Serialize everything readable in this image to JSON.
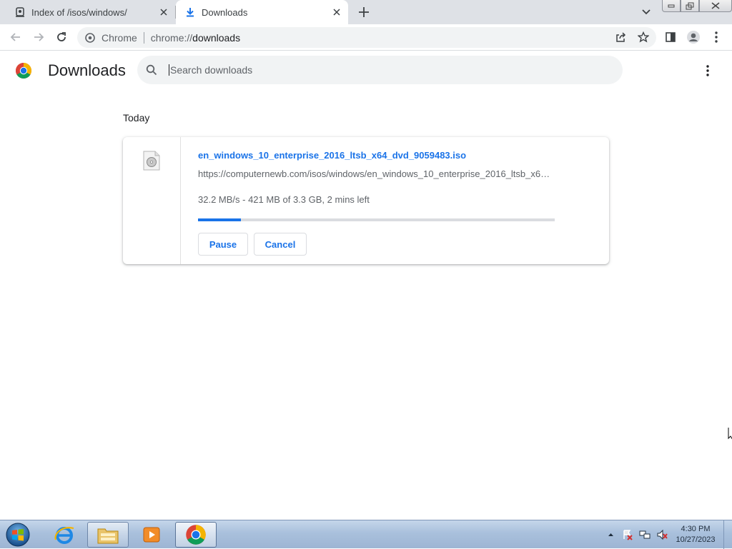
{
  "browser": {
    "tabs": [
      {
        "title": "Index of /isos/windows/",
        "icon": "server-icon",
        "active": false
      },
      {
        "title": "Downloads",
        "icon": "download-icon",
        "active": true
      }
    ],
    "omnibox": {
      "chip": "Chrome",
      "url_scheme": "chrome://",
      "url_host": "downloads"
    }
  },
  "page": {
    "title": "Downloads",
    "search_placeholder": "Search downloads",
    "date_heading": "Today"
  },
  "download": {
    "file_name": "en_windows_10_enterprise_2016_ltsb_x64_dvd_9059483.iso",
    "url": "https://computernewb.com/isos/windows/en_windows_10_enterprise_2016_ltsb_x6…",
    "status": "32.2 MB/s - 421 MB of 3.3 GB, 2 mins left",
    "progress_fraction": 0.12,
    "pause_label": "Pause",
    "cancel_label": "Cancel"
  },
  "taskbar": {
    "time": "4:30 PM",
    "date": "10/27/2023",
    "apps": [
      "internet-explorer-icon",
      "file-explorer-icon",
      "media-player-icon",
      "chrome-icon"
    ]
  },
  "colors": {
    "accent": "#1a73e8",
    "tabstrip": "#dee1e6",
    "omnibox": "#f1f3f4"
  }
}
